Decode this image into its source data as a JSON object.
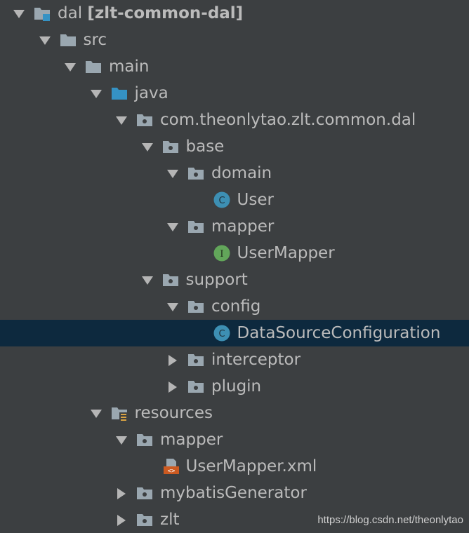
{
  "tree": [
    {
      "label": "dal",
      "extra": "[zlt-common-dal]",
      "icon": "module-folder-icon",
      "expanded": true,
      "level": 0
    },
    {
      "label": "src",
      "icon": "folder-icon",
      "expanded": true,
      "level": 1
    },
    {
      "label": "main",
      "icon": "folder-icon",
      "expanded": true,
      "level": 2
    },
    {
      "label": "java",
      "icon": "source-root-folder-icon",
      "expanded": true,
      "level": 3
    },
    {
      "label": "com.theonlytao.zlt.common.dal",
      "icon": "package-icon",
      "expanded": true,
      "level": 4
    },
    {
      "label": "base",
      "icon": "package-icon",
      "expanded": true,
      "level": 5
    },
    {
      "label": "domain",
      "icon": "package-icon",
      "expanded": true,
      "level": 6
    },
    {
      "label": "User",
      "icon": "class-icon",
      "level": 7
    },
    {
      "label": "mapper",
      "icon": "package-icon",
      "expanded": true,
      "level": 6
    },
    {
      "label": "UserMapper",
      "icon": "interface-icon",
      "level": 7
    },
    {
      "label": "support",
      "icon": "package-icon",
      "expanded": true,
      "level": 5
    },
    {
      "label": "config",
      "icon": "package-icon",
      "expanded": true,
      "level": 6
    },
    {
      "label": "DataSourceConfiguration",
      "icon": "class-icon",
      "level": 7,
      "selected": true
    },
    {
      "label": "interceptor",
      "icon": "package-icon",
      "expanded": false,
      "level": 6
    },
    {
      "label": "plugin",
      "icon": "package-icon",
      "expanded": false,
      "level": 6
    },
    {
      "label": "resources",
      "icon": "resources-folder-icon",
      "expanded": true,
      "level": 3
    },
    {
      "label": "mapper",
      "icon": "package-icon",
      "expanded": true,
      "level": 4
    },
    {
      "label": "UserMapper.xml",
      "icon": "xml-file-icon",
      "level": 5
    },
    {
      "label": "mybatisGenerator",
      "icon": "package-icon",
      "expanded": false,
      "level": 4
    },
    {
      "label": "zlt",
      "icon": "package-icon",
      "expanded": false,
      "level": 4
    }
  ],
  "watermark": "https://blog.csdn.net/theonlytao",
  "colors": {
    "background": "#3c3f41",
    "selection": "#0d293e",
    "text": "#bbbbbb",
    "folder": "#9aa7b0",
    "source_root": "#3592c4",
    "class_badge": "#3d8fb3",
    "interface_badge": "#62a65a",
    "xml_orange": "#cc5a21"
  }
}
